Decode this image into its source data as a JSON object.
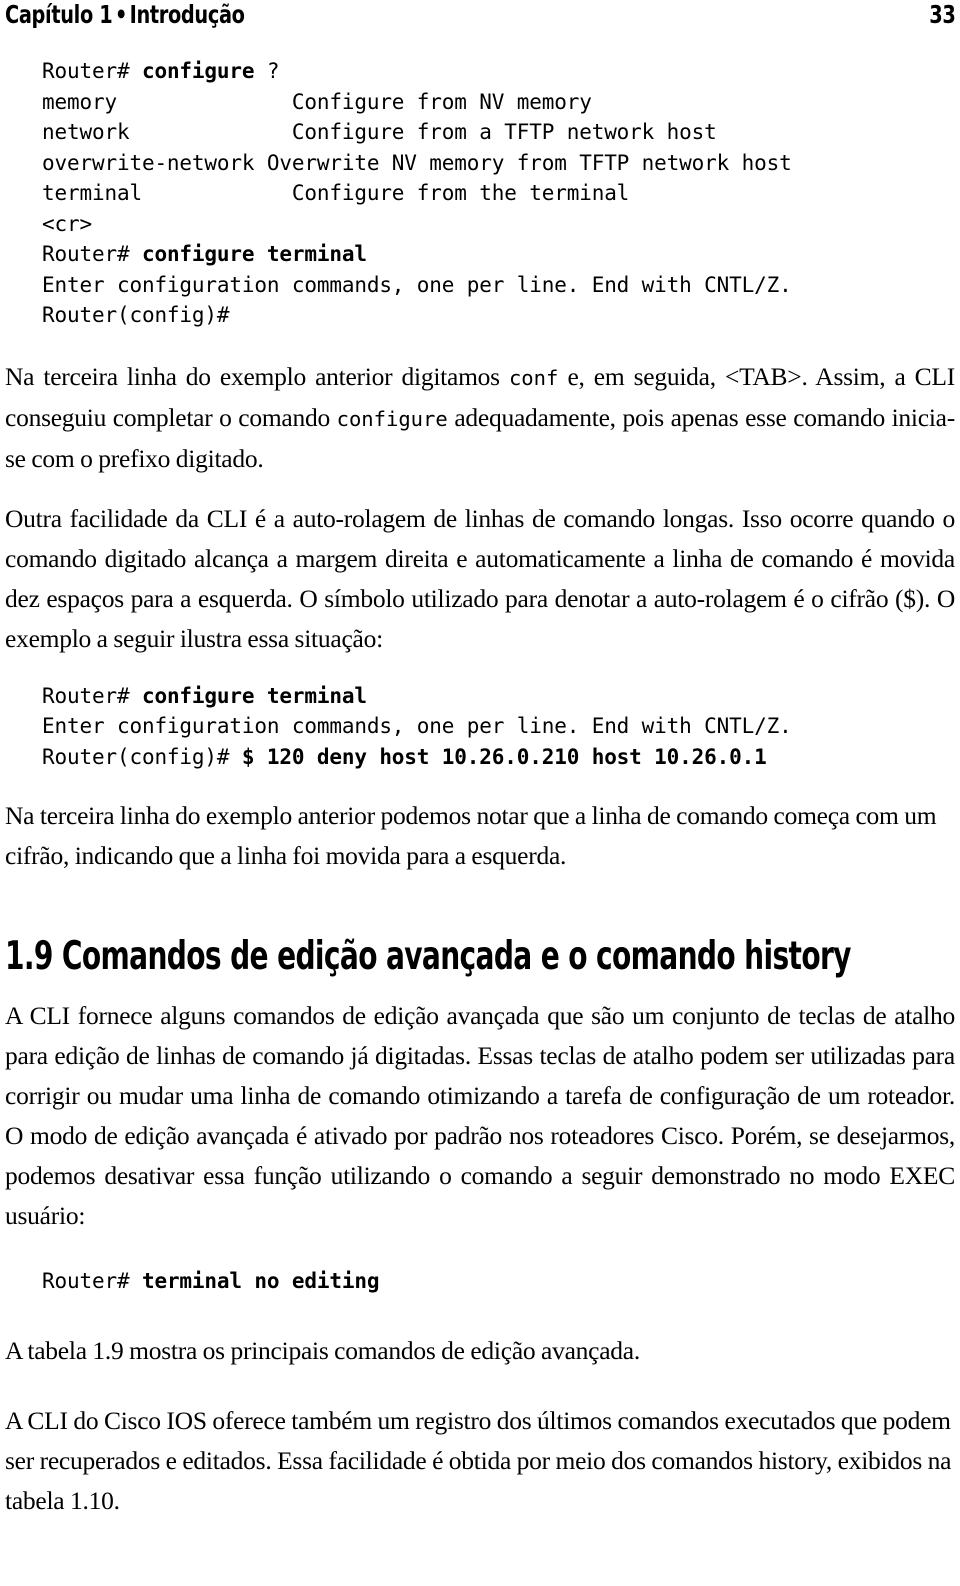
{
  "page": {
    "folio": "33",
    "running_head": {
      "chapter": "Capítulo 1",
      "separator": "•",
      "title": "Introdução"
    }
  },
  "code_blocks": {
    "configure_help": {
      "lines": [
        {
          "prompt": "Router# ",
          "command": "configure",
          "tail": " ?"
        },
        {
          "prompt": "",
          "command": "",
          "tail": "memory              Configure from NV memory"
        },
        {
          "prompt": "",
          "command": "",
          "tail": "network             Configure from a TFTP network host"
        },
        {
          "prompt": "",
          "command": "",
          "tail": "overwrite-network Overwrite NV memory from TFTP network host"
        },
        {
          "prompt": "",
          "command": "",
          "tail": "terminal            Configure from the terminal"
        },
        {
          "prompt": "",
          "command": "",
          "tail": "<cr>"
        },
        {
          "prompt": "Router# ",
          "command": "configure terminal",
          "tail": ""
        },
        {
          "prompt": "",
          "command": "",
          "tail": "Enter configuration commands, one per line. End with CNTL/Z."
        },
        {
          "prompt": "",
          "command": "",
          "tail": "Router(config)#"
        }
      ],
      "plain_text": "Router# configure ?\nmemory              Configure from NV memory\nnetwork             Configure from a TFTP network host\noverwrite-network Overwrite NV memory from TFTP network host\nterminal            Configure from the terminal\n<cr>\nRouter# configure terminal\nEnter configuration commands, one per line. End with CNTL/Z.\nRouter(config)#"
    },
    "autoscroll_example": {
      "lines": [
        {
          "prompt": "Router# ",
          "command": "configure terminal",
          "tail": ""
        },
        {
          "prompt": "",
          "command": "",
          "tail": "Enter configuration commands, one per line. End with CNTL/Z."
        },
        {
          "prompt": "Router(config)# ",
          "command": "$ 120 deny host 10.26.0.210 host 10.26.0.1",
          "tail": ""
        }
      ],
      "plain_text": "Router# configure terminal\nEnter configuration commands, one per line. End with CNTL/Z.\nRouter(config)# $ 120 deny host 10.26.0.210 host 10.26.0.1"
    },
    "terminal_no_editing": {
      "lines": [
        {
          "prompt": "Router# ",
          "command": "terminal no editing",
          "tail": ""
        }
      ],
      "plain_text": "Router# terminal no editing"
    }
  },
  "paragraphs": {
    "p1_part1": "Na terceira linha do exemplo anterior digitamos ",
    "p1_mono1": "conf",
    "p1_part2": " e, em seguida, <TAB>. Assim, a CLI conseguiu completar o comando ",
    "p1_mono2": "configure",
    "p1_part3": " adequadamente, pois apenas esse comando inicia-se com o prefixo digitado.",
    "p2": "Outra facilidade da CLI é a auto-rolagem de linhas de comando longas. Isso ocorre quando o comando digitado alcança a margem direita e automaticamente a linha de comando é movida dez espaços para a esquerda. O símbolo utilizado para denotar a auto-rolagem é o cifrão ($). O exemplo a seguir ilustra essa situação:",
    "p3": "Na terceira linha do exemplo anterior podemos notar que a linha de comando começa com um cifrão, indicando que a linha foi movida para a esquerda.",
    "p4": "A CLI fornece alguns comandos de edição avançada que são um conjunto de teclas de atalho para edição de linhas de comando já digitadas. Essas teclas de atalho podem ser utilizadas para corrigir ou mudar uma linha de comando otimizando a tarefa de configuração de um roteador.  O modo de edição avançada é ativado por padrão nos roteadores Cisco. Porém, se desejarmos, podemos desativar essa função utilizando o comando a seguir demonstrado no modo EXEC usuário:",
    "p5": "A tabela 1.9 mostra os principais comandos de edição avançada.",
    "p6": "A CLI do Cisco IOS oferece também um registro dos últimos comandos executados que podem ser recuperados e editados. Essa facilidade é obtida por meio dos comandos history, exibidos na tabela 1.10."
  },
  "headings": {
    "section_1_9": "1.9 Comandos de edição avançada e o comando history"
  }
}
